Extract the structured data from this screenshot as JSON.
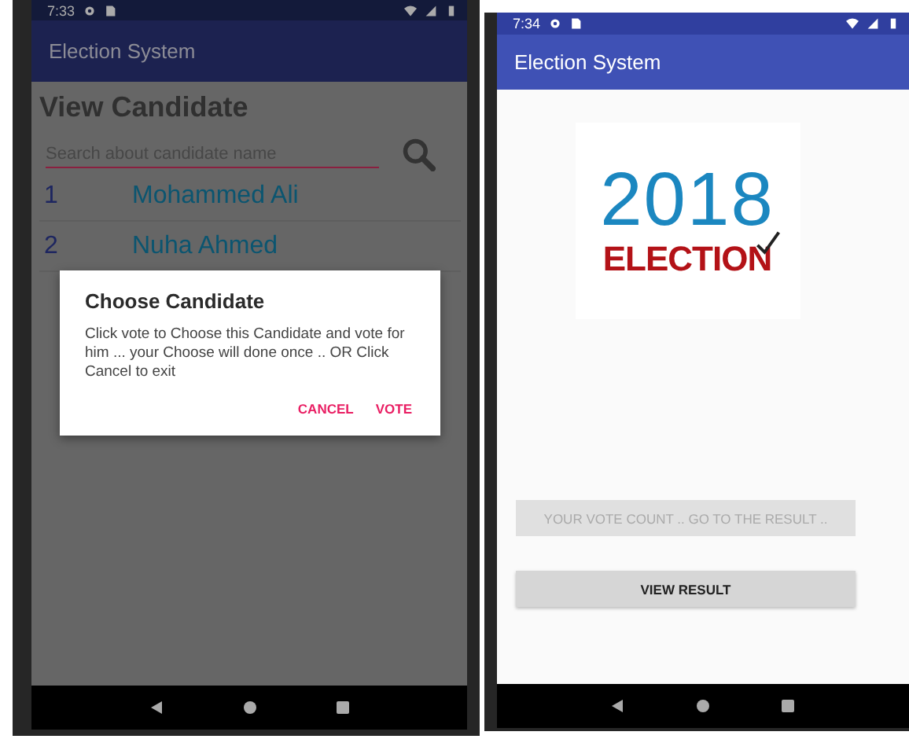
{
  "left_screen": {
    "status_bar": {
      "time": "7:33"
    },
    "app_bar": {
      "title": "Election System"
    },
    "heading": "View Candidate",
    "search": {
      "placeholder": "Search about candidate name"
    },
    "candidates": [
      {
        "number": "1",
        "name": "Mohammed Ali"
      },
      {
        "number": "2",
        "name": "Nuha Ahmed"
      }
    ],
    "dialog": {
      "title": "Choose Candidate",
      "message": "Click vote to Choose this Candidate and vote for him ... your Choose will done once .. OR Click Cancel to exit",
      "buttons": [
        "CANCEL",
        "VOTE"
      ]
    }
  },
  "right_screen": {
    "status_bar": {
      "time": "7:34"
    },
    "app_bar": {
      "title": "Election System"
    },
    "logo": {
      "year": "2018",
      "word": "ELECTION"
    },
    "buttons": [
      {
        "label": "YOUR VOTE COUNT .. GO TO THE RESULT ..",
        "disabled": true
      },
      {
        "label": "VIEW RESULT",
        "disabled": false
      }
    ]
  }
}
